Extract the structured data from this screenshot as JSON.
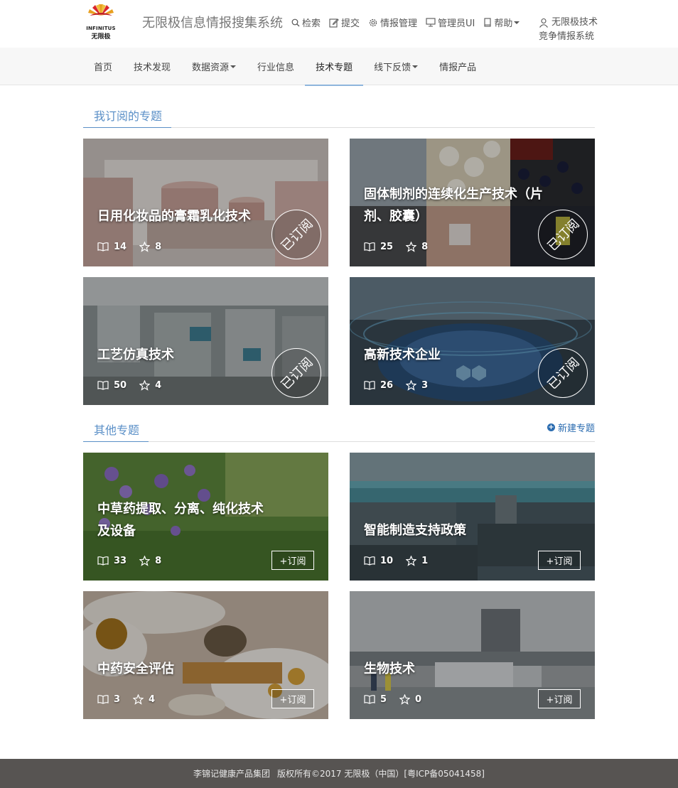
{
  "header": {
    "logo_en": "INFINITUS",
    "logo_cn": "无限极",
    "title": "无限极信息情报搜集系统",
    "nav": [
      {
        "label": "检索",
        "icon": "search-icon"
      },
      {
        "label": "提交",
        "icon": "edit-icon"
      },
      {
        "label": "情报管理",
        "icon": "gear-icon"
      },
      {
        "label": "管理员UI",
        "icon": "monitor-icon"
      },
      {
        "label": "帮助",
        "icon": "book-icon"
      }
    ],
    "user_line1": "无限极技术",
    "user_line2": "竞争情报系统"
  },
  "main_nav": [
    {
      "label": "首页",
      "dropdown": false
    },
    {
      "label": "技术发现",
      "dropdown": false
    },
    {
      "label": "数据资源",
      "dropdown": true
    },
    {
      "label": "行业信息",
      "dropdown": false
    },
    {
      "label": "技术专题",
      "dropdown": false,
      "active": true
    },
    {
      "label": "线下反馈",
      "dropdown": true
    },
    {
      "label": "情报产品",
      "dropdown": false
    }
  ],
  "subscribed": {
    "title": "我订阅的专题",
    "badge_label": "已订阅",
    "cards": [
      {
        "title": "日用化妆品的膏霜乳化技术",
        "docs": "14",
        "stars": "8"
      },
      {
        "title": "固体制剂的连续化生产技术（片剂、胶囊）",
        "docs": "25",
        "stars": "8"
      },
      {
        "title": "工艺仿真技术",
        "docs": "50",
        "stars": "4"
      },
      {
        "title": "高新技术企业",
        "docs": "26",
        "stars": "3"
      }
    ]
  },
  "others": {
    "title": "其他专题",
    "new_label": "新建专题",
    "button_label": "+订阅",
    "cards": [
      {
        "title": "中草药提取、分离、纯化技术及设备",
        "docs": "33",
        "stars": "8"
      },
      {
        "title": "智能制造支持政策",
        "docs": "10",
        "stars": "1"
      },
      {
        "title": "中药安全评估",
        "docs": "3",
        "stars": "4"
      },
      {
        "title": "生物技术",
        "docs": "5",
        "stars": "0"
      }
    ]
  },
  "footer": {
    "company": "李锦记健康产品集团",
    "copyright": "版权所有©2017 无限极（中国）[粤ICP备05041458]"
  },
  "colors": {
    "accent": "#5a8fc7",
    "link": "#2b6cb0",
    "footer_bg": "#575452",
    "nav_bg": "#f7f7f7"
  }
}
